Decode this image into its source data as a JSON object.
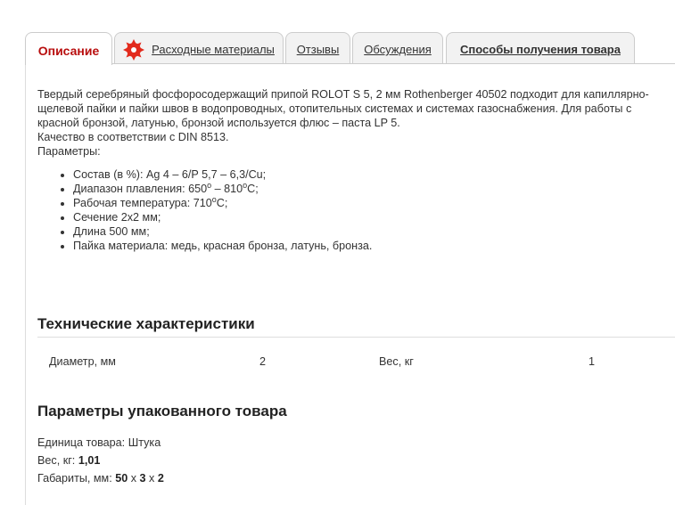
{
  "tabs": [
    {
      "label": "Описание",
      "active": true
    },
    {
      "label": "Расходные материалы",
      "icon": "saw-blade-icon"
    },
    {
      "label": "Отзывы"
    },
    {
      "label": "Обсуждения"
    },
    {
      "label": "Способы получения товара"
    }
  ],
  "description": {
    "text": "Твердый серебряный фосфоросодержащий припой ROLOT S 5, 2 мм Rothenberger 40502 подходит для капиллярно-щелевой пайки и пайки швов в водопроводных, отопительных системах и системах газоснабжения. Для работы с красной бронзой, латунью, бронзой используется флюс – паста LP 5.",
    "quality": "Качество в соответствии с DIN 8513.",
    "params_label": "Параметры:",
    "params": {
      "composition": "Состав (в %): Ag 4 – 6/P 5,7 – 6,3/Cu;",
      "melting_prefix": "Диапазон плавления: 650",
      "melting_mid": " – 810",
      "melting_suffix": "C;",
      "work_prefix": "Рабочая температура: 710",
      "work_suffix": "C;",
      "degree": "о",
      "section": "Сечение 2х2 мм;",
      "length": "Длина 500 мм;",
      "materials": "Пайка материала: медь, красная бронза, латунь, бронза."
    }
  },
  "tech": {
    "title": "Технические характеристики",
    "rows": [
      {
        "label": "Диаметр, мм",
        "value": "2"
      },
      {
        "label": "Вес, кг",
        "value": "1"
      }
    ]
  },
  "package": {
    "title": "Параметры упакованного товара",
    "unit_label": "Единица товара: ",
    "unit_value": "Штука",
    "weight_label": "Вес, кг: ",
    "weight_value": "1,01",
    "dims_label": "Габариты, мм: ",
    "dim_a": "50",
    "dim_b": "3",
    "dim_c": "2",
    "sep": " x "
  },
  "colors": {
    "accent": "#b80d0d",
    "icon": "#e22a1c",
    "tab_bg": "#f2f2f2",
    "border": "#cccccc"
  }
}
